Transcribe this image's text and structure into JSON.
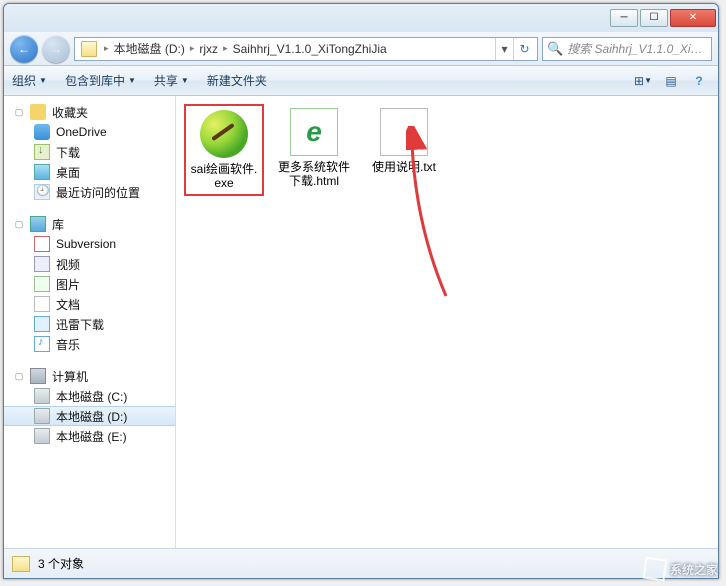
{
  "breadcrumbs": [
    "本地磁盘 (D:)",
    "rjxz",
    "Saihhrj_V1.1.0_XiTongZhiJia"
  ],
  "search_placeholder": "搜索 Saihhrj_V1.1.0_XiTon...",
  "toolbar": {
    "organize": "组织",
    "include": "包含到库中",
    "share": "共享",
    "new_folder": "新建文件夹"
  },
  "tree": {
    "favorites": {
      "label": "收藏夹",
      "items": [
        "OneDrive",
        "下载",
        "桌面",
        "最近访问的位置"
      ]
    },
    "libraries": {
      "label": "库",
      "items": [
        "Subversion",
        "视频",
        "图片",
        "文档",
        "迅雷下载",
        "音乐"
      ]
    },
    "computer": {
      "label": "计算机",
      "items": [
        "本地磁盘 (C:)",
        "本地磁盘 (D:)",
        "本地磁盘 (E:)"
      ]
    }
  },
  "files": [
    {
      "name": "sai绘画软件.exe",
      "type": "sai",
      "highlight": true
    },
    {
      "name": "更多系统软件下载.html",
      "type": "html",
      "highlight": false
    },
    {
      "name": "使用说明.txt",
      "type": "txt",
      "highlight": false
    }
  ],
  "status": {
    "count_label": "3 个对象"
  },
  "watermark": "系统之家"
}
